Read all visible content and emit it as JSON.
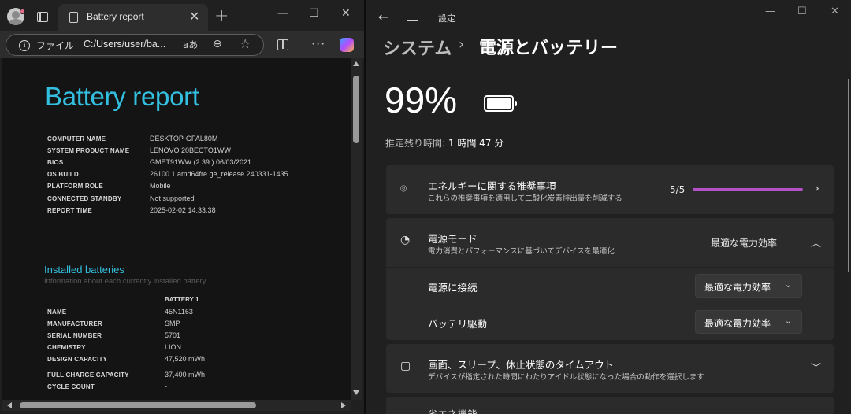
{
  "edge": {
    "tab_title": "Battery report",
    "address_label": "ファイル",
    "url": "C:/Users/user/ba...",
    "read_aloud": "aあ"
  },
  "report": {
    "title": "Battery report",
    "system_info": [
      {
        "key": "COMPUTER NAME",
        "value": "DESKTOP-GFAL80M"
      },
      {
        "key": "SYSTEM PRODUCT NAME",
        "value": "LENOVO 20BECTO1WW"
      },
      {
        "key": "BIOS",
        "value": "GMET91WW (2.39 ) 06/03/2021"
      },
      {
        "key": "OS BUILD",
        "value": "26100.1.amd64fre.ge_release.240331-1435"
      },
      {
        "key": "PLATFORM ROLE",
        "value": "Mobile"
      },
      {
        "key": "CONNECTED STANDBY",
        "value": "Not supported"
      },
      {
        "key": "REPORT TIME",
        "value": "2025-02-02  14:33:38"
      }
    ],
    "installed_title": "Installed batteries",
    "installed_subtitle": "Information about each currently installed battery",
    "battery_column": "BATTERY 1",
    "battery_rows": [
      {
        "key": "NAME",
        "value": "45N1163"
      },
      {
        "key": "MANUFACTURER",
        "value": "SMP"
      },
      {
        "key": "SERIAL NUMBER",
        "value": "5701"
      },
      {
        "key": "CHEMISTRY",
        "value": "LION"
      },
      {
        "key": "DESIGN CAPACITY",
        "value": "47,520 mWh"
      },
      {
        "key": "FULL CHARGE CAPACITY",
        "value": "37,400 mWh"
      },
      {
        "key": "CYCLE COUNT",
        "value": "-"
      }
    ]
  },
  "settings": {
    "app_title": "設定",
    "breadcrumb_parent": "システム",
    "breadcrumb_sep": "›",
    "breadcrumb_current": "電源とバッテリー",
    "battery_percent": "99%",
    "battery_level": 0.99,
    "remaining_label": "推定残り時間:",
    "remaining_value": "1 時間 47 分",
    "energy": {
      "title": "エネルギーに関する推奨事項",
      "subtitle": "これらの推奨事項を適用して二酸化炭素排出量を削減する",
      "score": "5/5",
      "score_fraction": 1.0
    },
    "power_mode": {
      "title": "電源モード",
      "subtitle": "電力消費とパフォーマンスに基づいてデバイスを最適化",
      "value": "最適な電力効率",
      "plugged_label": "電源に接続",
      "plugged_value": "最適な電力効率",
      "battery_label": "バッテリ駆動",
      "battery_value": "最適な電力効率"
    },
    "screen_sleep": {
      "title": "画面、スリープ、休止状態のタイムアウト",
      "subtitle": "デバイスが指定された時間にわたりアイドル状態になった場合の動作を選択します"
    },
    "next_item": "省エネ機能"
  }
}
